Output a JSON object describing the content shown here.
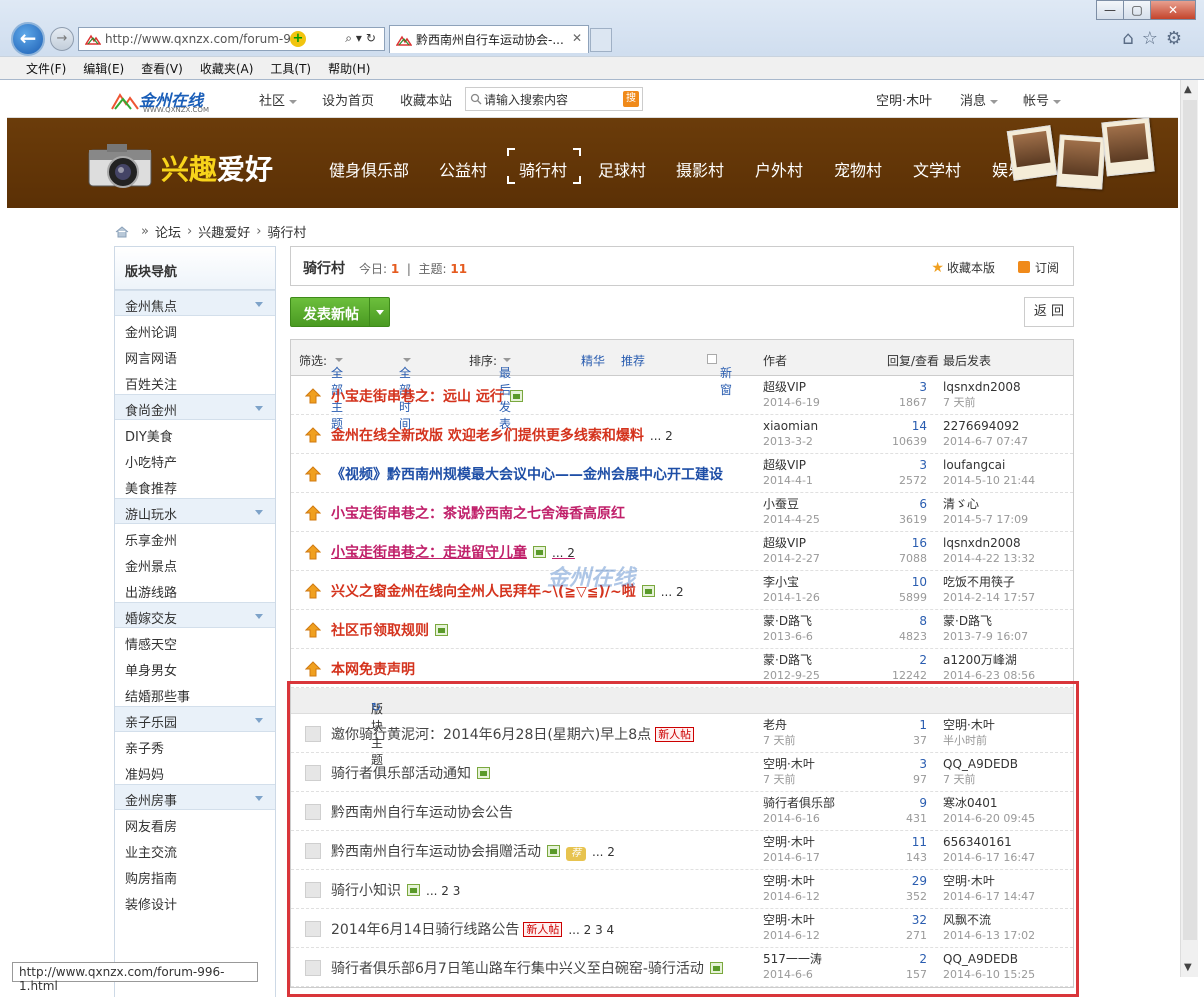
{
  "browser": {
    "url": "http://www.qxnzx.com/forum-99",
    "tab_title": "黔西南州自行车运动协会-...",
    "menu": [
      "文件(F)",
      "编辑(E)",
      "查看(V)",
      "收藏夹(A)",
      "工具(T)",
      "帮助(H)"
    ],
    "status_url": "http://www.qxnzx.com/forum-996-1.html"
  },
  "site": {
    "logo_text": "金州在线",
    "logo_sub": "WWW.QXNZX.COM",
    "nav": [
      "社区",
      "设为首页",
      "收藏本站"
    ],
    "search_placeholder": "请输入搜索内容",
    "search_btn": "搜",
    "user": "空明·木叶",
    "msg": "消息",
    "account": "帐号"
  },
  "banner": {
    "title_y": "兴趣",
    "title_w": "爱好",
    "nav": [
      "健身俱乐部",
      "公益村",
      "骑行村",
      "足球村",
      "摄影村",
      "户外村",
      "宠物村",
      "文学村",
      "娱乐村"
    ]
  },
  "breadcrumb": [
    "论坛",
    "兴趣爱好",
    "骑行村"
  ],
  "sidebar": {
    "title": "版块导航",
    "groups": [
      {
        "name": "金州焦点",
        "items": [
          "金州论调",
          "网言网语",
          "百姓关注"
        ]
      },
      {
        "name": "食尚金州",
        "items": [
          "DIY美食",
          "小吃特产",
          "美食推荐"
        ]
      },
      {
        "name": "游山玩水",
        "items": [
          "乐享金州",
          "金州景点",
          "出游线路"
        ]
      },
      {
        "name": "婚嫁交友",
        "items": [
          "情感天空",
          "单身男女",
          "结婚那些事"
        ]
      },
      {
        "name": "亲子乐园",
        "items": [
          "亲子秀",
          "准妈妈"
        ]
      },
      {
        "name": "金州房事",
        "items": [
          "网友看房",
          "业主交流",
          "购房指南",
          "装修设计"
        ]
      }
    ]
  },
  "forum": {
    "name": "骑行村",
    "today_label": "今日:",
    "today": "1",
    "topic_label": "主题:",
    "topics": "11",
    "fav": "收藏本版",
    "subscribe": "订阅",
    "post_btn": "发表新帖",
    "back_btn": "返 回"
  },
  "filter": {
    "label": "筛选:",
    "all_topics": "全部主题",
    "all_time": "全部时间",
    "sort_label": "排序:",
    "sort": "最后发表",
    "digest": "精华",
    "recommend": "推荐",
    "newwin": "新窗",
    "author": "作者",
    "replies": "回复/查看",
    "last": "最后发表"
  },
  "sticky": [
    {
      "title": "小宝走街串巷之：远山 远行",
      "cls": "red",
      "img": true,
      "pages": "",
      "author": "超级VIP",
      "date": "2014-6-19",
      "r": "3",
      "v": "1867",
      "lp": "lqsnxdn2008",
      "lpd": "7 天前"
    },
    {
      "title": "金州在线全新改版 欢迎老乡们提供更多线索和爆料",
      "cls": "red",
      "img": false,
      "pages": "... 2",
      "author": "xiaomian",
      "date": "2013-3-2",
      "r": "14",
      "v": "10639",
      "lp": "2276694092",
      "lpd": "2014-6-7 07:47"
    },
    {
      "title": "《视频》黔西南州规模最大会议中心——金州会展中心开工建设",
      "cls": "blue",
      "img": false,
      "pages": "",
      "author": "超级VIP",
      "date": "2014-4-1",
      "r": "3",
      "v": "2572",
      "lp": "loufangcai",
      "lpd": "2014-5-10 21:44"
    },
    {
      "title": "小宝走街串巷之：茶说黔西南之七舍海香高原红",
      "cls": "pink",
      "img": false,
      "pages": "",
      "author": "小蚕豆",
      "date": "2014-4-25",
      "r": "6",
      "v": "3619",
      "lp": "清ゞ心",
      "lpd": "2014-5-7 17:09"
    },
    {
      "title": "小宝走街串巷之：走进留守儿童",
      "cls": "pink und",
      "img": true,
      "pages": "... 2",
      "author": "超级VIP",
      "date": "2014-2-27",
      "r": "16",
      "v": "7088",
      "lp": "lqsnxdn2008",
      "lpd": "2014-4-22 13:32"
    },
    {
      "title": "兴义之窗金州在线向全州人民拜年~\\(≧▽≦)/~啦",
      "cls": "red",
      "img": true,
      "pages": "... 2",
      "author": "李小宝",
      "date": "2014-1-26",
      "r": "10",
      "v": "5899",
      "lp": "吃饭不用筷子",
      "lpd": "2014-2-14 17:57"
    },
    {
      "title": "社区币领取规则",
      "cls": "red",
      "img": true,
      "pages": "",
      "author": "蒙·D路飞",
      "date": "2013-6-6",
      "r": "8",
      "v": "4823",
      "lp": "蒙·D路飞",
      "lpd": "2013-7-9 16:07"
    },
    {
      "title": "本网免责声明",
      "cls": "red",
      "img": false,
      "pages": "",
      "author": "蒙·D路飞",
      "date": "2012-9-25",
      "r": "2",
      "v": "12242",
      "lp": "a1200万峰湖",
      "lpd": "2014-6-23 08:56"
    }
  ],
  "section_title": "版块主题",
  "normal": [
    {
      "title": "邀你骑行黄泥河：2014年6月28日(星期六)早上8点",
      "new": true,
      "img": false,
      "jian": false,
      "pages": "",
      "author": "老舟",
      "date": "7 天前",
      "r": "1",
      "v": "37",
      "lp": "空明·木叶",
      "lpd": "半小时前"
    },
    {
      "title": "骑行者俱乐部活动通知",
      "new": false,
      "img": true,
      "jian": false,
      "pages": "",
      "author": "空明·木叶",
      "date": "7 天前",
      "r": "3",
      "v": "97",
      "lp": "QQ_A9DEDB",
      "lpd": "7 天前"
    },
    {
      "title": "黔西南州自行车运动协会公告",
      "new": false,
      "img": false,
      "jian": false,
      "pages": "",
      "author": "骑行者俱乐部",
      "date": "2014-6-16",
      "r": "9",
      "v": "431",
      "lp": "寒冰0401",
      "lpd": "2014-6-20 09:45"
    },
    {
      "title": "黔西南州自行车运动协会捐赠活动",
      "new": false,
      "img": true,
      "jian": true,
      "pages": "... 2",
      "author": "空明·木叶",
      "date": "2014-6-17",
      "r": "11",
      "v": "143",
      "lp": "656340161",
      "lpd": "2014-6-17 16:47"
    },
    {
      "title": "骑行小知识",
      "new": false,
      "img": true,
      "jian": false,
      "pages": "... 2  3",
      "author": "空明·木叶",
      "date": "2014-6-12",
      "r": "29",
      "v": "352",
      "lp": "空明·木叶",
      "lpd": "2014-6-17 14:47"
    },
    {
      "title": "2014年6月14日骑行线路公告",
      "new": true,
      "img": false,
      "jian": false,
      "pages": "... 2  3  4",
      "author": "空明·木叶",
      "date": "2014-6-12",
      "r": "32",
      "v": "271",
      "lp": "风飘不流",
      "lpd": "2014-6-13 17:02"
    },
    {
      "title": "骑行者俱乐部6月7日笔山路车行集中兴义至白碗窑-骑行活动",
      "new": false,
      "img": true,
      "jian": false,
      "pages": "",
      "author": "517一一涛",
      "date": "2014-6-6",
      "r": "2",
      "v": "157",
      "lp": "QQ_A9DEDB",
      "lpd": "2014-6-10 15:25"
    }
  ],
  "labels": {
    "new": "新人帖",
    "jian": "荐"
  },
  "watermark": "金州在线"
}
